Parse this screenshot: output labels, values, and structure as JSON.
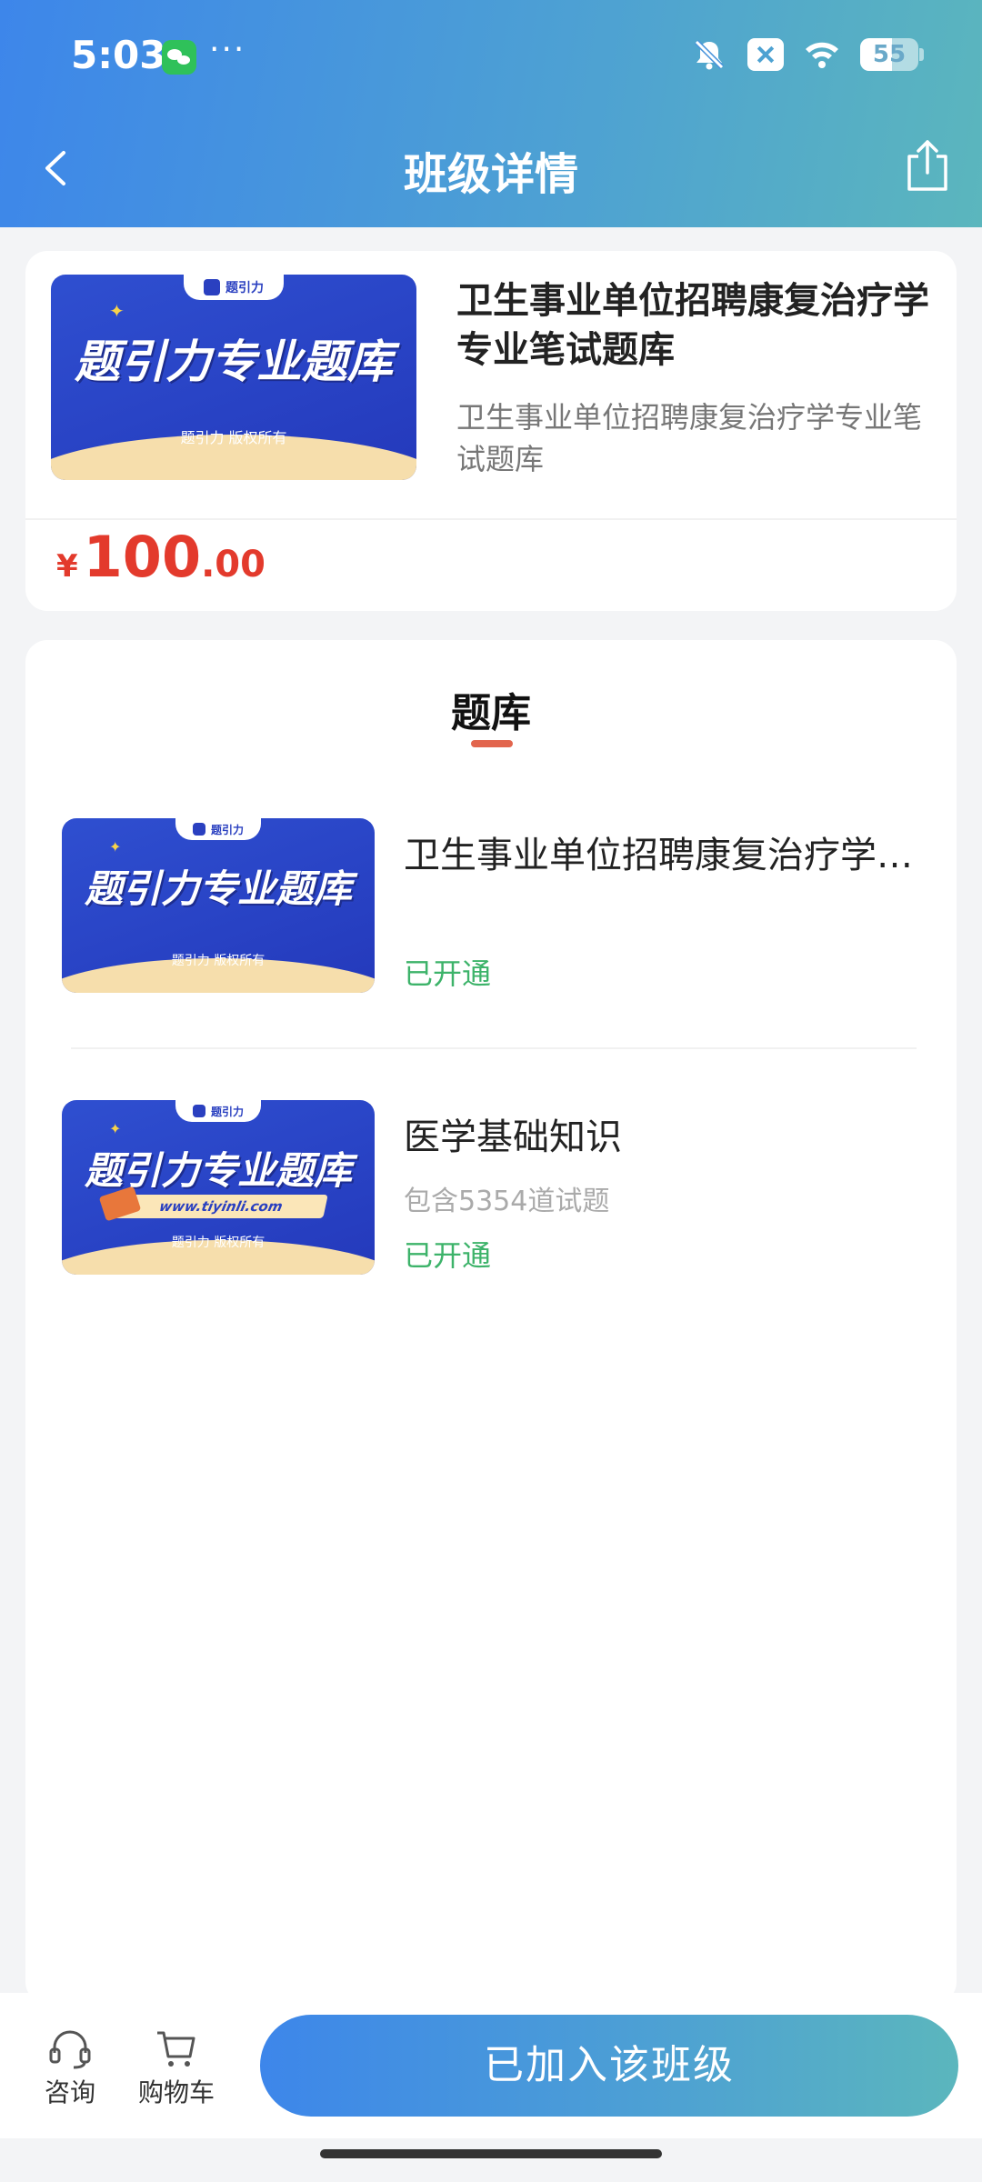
{
  "status_bar": {
    "time": "5:03",
    "dots": "···",
    "battery": "55"
  },
  "nav": {
    "title": "班级详情"
  },
  "product": {
    "banner_tag": "题引力",
    "banner_title": "题引力专业题库",
    "banner_copyright": "题引力 版权所有",
    "title": "卫生事业单位招聘康复治疗学专业笔试题库",
    "subtitle": "卫生事业单位招聘康复治疗学专业笔试题库",
    "price_symbol": "¥",
    "price_integer": "100",
    "price_decimal": ".00"
  },
  "bank": {
    "tab_label": "题库",
    "items": [
      {
        "banner_tag": "题引力",
        "banner_title": "题引力专业题库",
        "banner_copyright": "题引力 版权所有",
        "title": "卫生事业单位招聘康复治疗学专业笔试题库",
        "meta": "",
        "status": "已开通"
      },
      {
        "banner_tag": "题引力",
        "banner_title": "题引力专业题库",
        "banner_url": "www.tiyinli.com",
        "banner_copyright": "题引力 版权所有",
        "title": "医学基础知识",
        "meta": "包含5354道试题",
        "status": "已开通"
      }
    ]
  },
  "bottom_bar": {
    "consult_label": "咨询",
    "cart_label": "购物车",
    "join_label": "已加入该班级"
  },
  "colors": {
    "header_gradient_start": "#3d86ea",
    "header_gradient_end": "#5bb6bd",
    "price_red": "#e33a2c",
    "status_green": "#3db36a",
    "tab_underline": "#e2654d"
  }
}
